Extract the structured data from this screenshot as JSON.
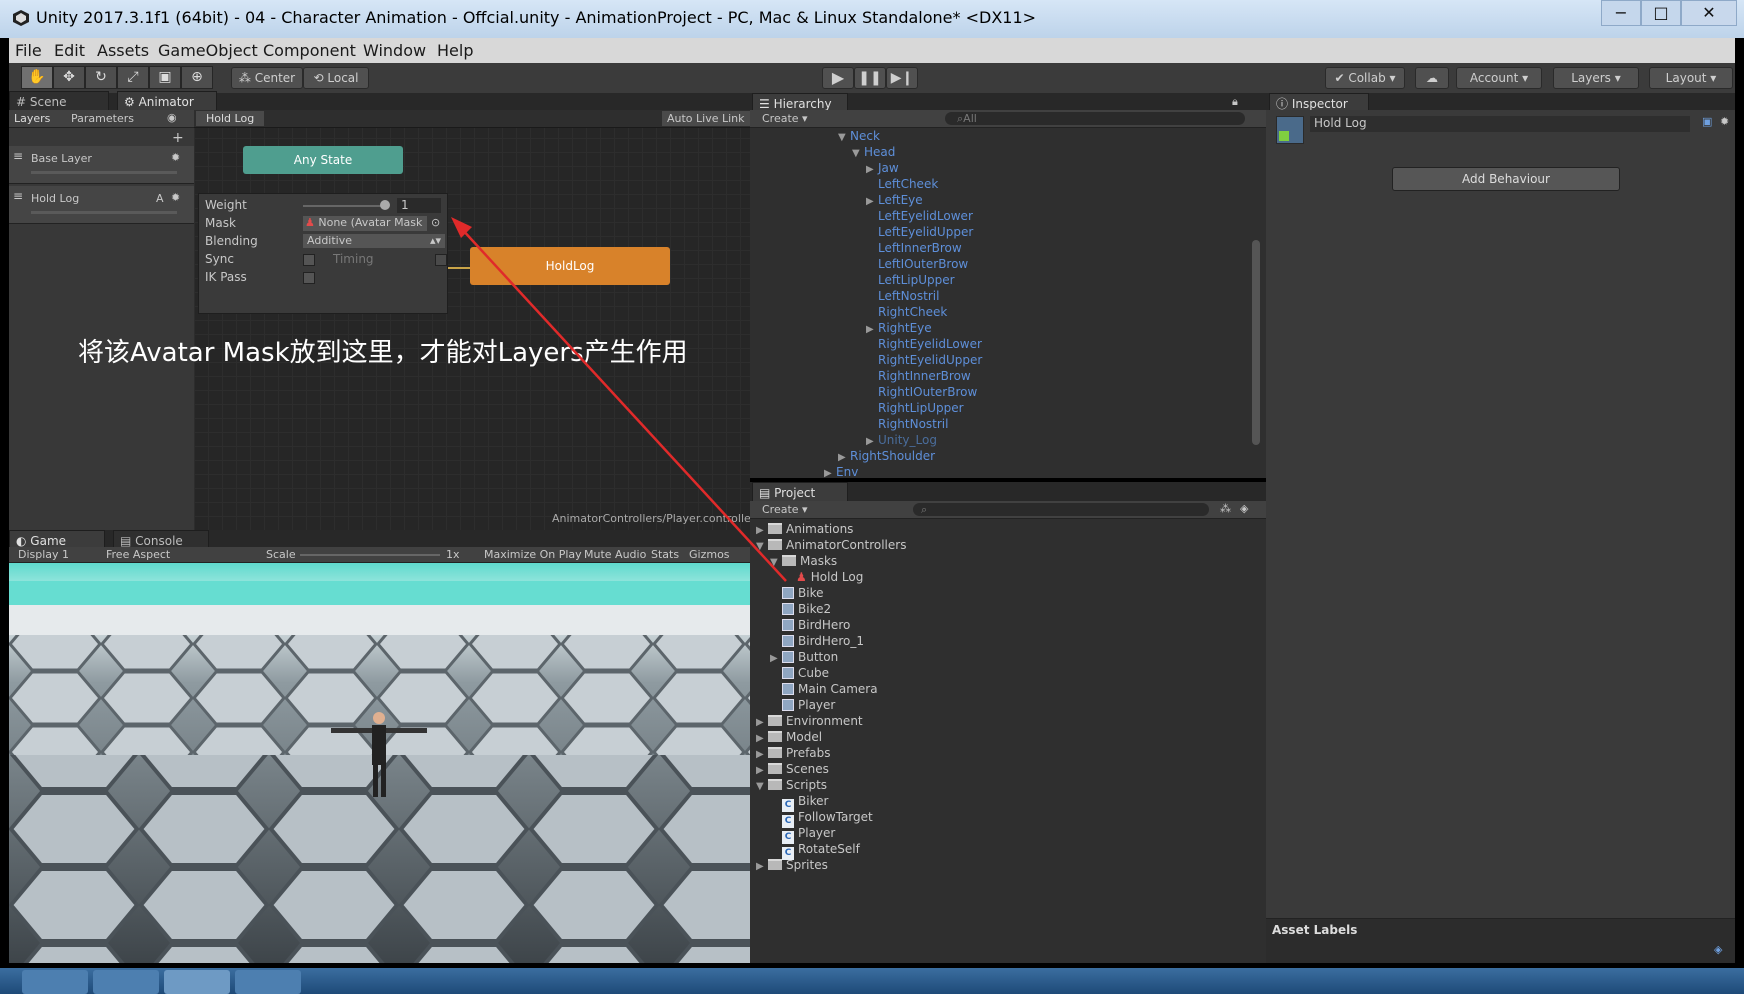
{
  "window": {
    "title": "Unity 2017.3.1f1 (64bit) - 04 - Character Animation - Offcial.unity - AnimationProject - PC, Mac & Linux Standalone* <DX11>",
    "minimize": "−",
    "maximize": "□",
    "close": "✕"
  },
  "menu": [
    "File",
    "Edit",
    "Assets",
    "GameObject",
    "Component",
    "Window",
    "Help"
  ],
  "toolbar": {
    "center": "Center",
    "local": "Local",
    "collab": "Collab",
    "account": "Account",
    "layers": "Layers",
    "layout": "Layout"
  },
  "scene_tabs": {
    "scene": "Scene",
    "animator": "Animator"
  },
  "animator": {
    "layers_tab": "Layers",
    "parameters_tab": "Parameters",
    "breadcrumb": "Hold Log",
    "auto_live_link": "Auto Live Link",
    "layer_base": "Base Layer",
    "layer_holdlog": "Hold Log",
    "layer_badge": "A",
    "any_state": "Any State",
    "holdlog_state": "HoldLog",
    "footer": "AnimatorControllers/Player.controller",
    "settings": {
      "weight_label": "Weight",
      "weight_value": "1",
      "mask_label": "Mask",
      "mask_value": "None (Avatar Mask",
      "blending_label": "Blending",
      "blending_value": "Additive",
      "sync_label": "Sync",
      "timing_label": "Timing",
      "ikpass_label": "IK Pass"
    },
    "annotation": "将该Avatar Mask放到这里，才能对Layers产生作用"
  },
  "hierarchy": {
    "tab": "Hierarchy",
    "create": "Create",
    "search_placeholder": "All",
    "items": [
      {
        "t": "Neck",
        "d": 0,
        "a": "▼"
      },
      {
        "t": "Head",
        "d": 1,
        "a": "▼"
      },
      {
        "t": "Jaw",
        "d": 2,
        "a": "▶"
      },
      {
        "t": "LeftCheek",
        "d": 2,
        "a": ""
      },
      {
        "t": "LeftEye",
        "d": 2,
        "a": "▶"
      },
      {
        "t": "LeftEyelidLower",
        "d": 2,
        "a": ""
      },
      {
        "t": "LeftEyelidUpper",
        "d": 2,
        "a": ""
      },
      {
        "t": "LeftInnerBrow",
        "d": 2,
        "a": ""
      },
      {
        "t": "LeftIOuterBrow",
        "d": 2,
        "a": ""
      },
      {
        "t": "LeftLipUpper",
        "d": 2,
        "a": ""
      },
      {
        "t": "LeftNostril",
        "d": 2,
        "a": ""
      },
      {
        "t": "RightCheek",
        "d": 2,
        "a": ""
      },
      {
        "t": "RightEye",
        "d": 2,
        "a": "▶"
      },
      {
        "t": "RightEyelidLower",
        "d": 2,
        "a": ""
      },
      {
        "t": "RightEyelidUpper",
        "d": 2,
        "a": ""
      },
      {
        "t": "RightInnerBrow",
        "d": 2,
        "a": ""
      },
      {
        "t": "RightIOuterBrow",
        "d": 2,
        "a": ""
      },
      {
        "t": "RightLipUpper",
        "d": 2,
        "a": ""
      },
      {
        "t": "RightNostril",
        "d": 2,
        "a": ""
      },
      {
        "t": "Unity_Log",
        "d": 2,
        "a": "▶"
      },
      {
        "t": "RightShoulder",
        "d": 0,
        "a": "▶"
      },
      {
        "t": "Env",
        "d": -1,
        "a": "▶"
      }
    ]
  },
  "project": {
    "tab": "Project",
    "create": "Create",
    "items": [
      {
        "t": "Animations",
        "d": 0,
        "k": "folder",
        "a": "▶"
      },
      {
        "t": "AnimatorControllers",
        "d": 0,
        "k": "folder",
        "a": "▼"
      },
      {
        "t": "Masks",
        "d": 1,
        "k": "folder",
        "a": "▼"
      },
      {
        "t": "Hold Log",
        "d": 2,
        "k": "mask",
        "a": ""
      },
      {
        "t": "Bike",
        "d": 1,
        "k": "prefab",
        "a": ""
      },
      {
        "t": "Bike2",
        "d": 1,
        "k": "prefab",
        "a": ""
      },
      {
        "t": "BirdHero",
        "d": 1,
        "k": "prefab",
        "a": ""
      },
      {
        "t": "BirdHero_1",
        "d": 1,
        "k": "prefab",
        "a": ""
      },
      {
        "t": "Button",
        "d": 1,
        "k": "prefab",
        "a": "▶"
      },
      {
        "t": "Cube",
        "d": 1,
        "k": "prefab",
        "a": ""
      },
      {
        "t": "Main Camera",
        "d": 1,
        "k": "prefab",
        "a": ""
      },
      {
        "t": "Player",
        "d": 1,
        "k": "prefab",
        "a": ""
      },
      {
        "t": "Environment",
        "d": 0,
        "k": "folder",
        "a": "▶"
      },
      {
        "t": "Model",
        "d": 0,
        "k": "folder",
        "a": "▶"
      },
      {
        "t": "Prefabs",
        "d": 0,
        "k": "folder",
        "a": "▶"
      },
      {
        "t": "Scenes",
        "d": 0,
        "k": "folder",
        "a": "▶"
      },
      {
        "t": "Scripts",
        "d": 0,
        "k": "folder",
        "a": "▼"
      },
      {
        "t": "Biker",
        "d": 1,
        "k": "cs",
        "a": ""
      },
      {
        "t": "FollowTarget",
        "d": 1,
        "k": "cs",
        "a": ""
      },
      {
        "t": "Player",
        "d": 1,
        "k": "cs",
        "a": ""
      },
      {
        "t": "RotateSelf",
        "d": 1,
        "k": "cs",
        "a": ""
      },
      {
        "t": "Sprites",
        "d": 0,
        "k": "folder",
        "a": "▶"
      }
    ]
  },
  "game": {
    "game_tab": "Game",
    "console_tab": "Console",
    "display": "Display 1",
    "aspect": "Free Aspect",
    "scale_label": "Scale",
    "scale_value": "1x",
    "maximize": "Maximize On Play",
    "mute": "Mute Audio",
    "stats": "Stats",
    "gizmos": "Gizmos"
  },
  "inspector": {
    "tab": "Inspector",
    "object_name": "Hold Log",
    "add_behaviour": "Add Behaviour",
    "asset_labels": "Asset Labels"
  },
  "colors": {
    "state_any": "#4f9e8f",
    "state_holdlog": "#d8822a",
    "arrow": "#e02a2a",
    "hierarchy_text": "#5e8fd9"
  }
}
